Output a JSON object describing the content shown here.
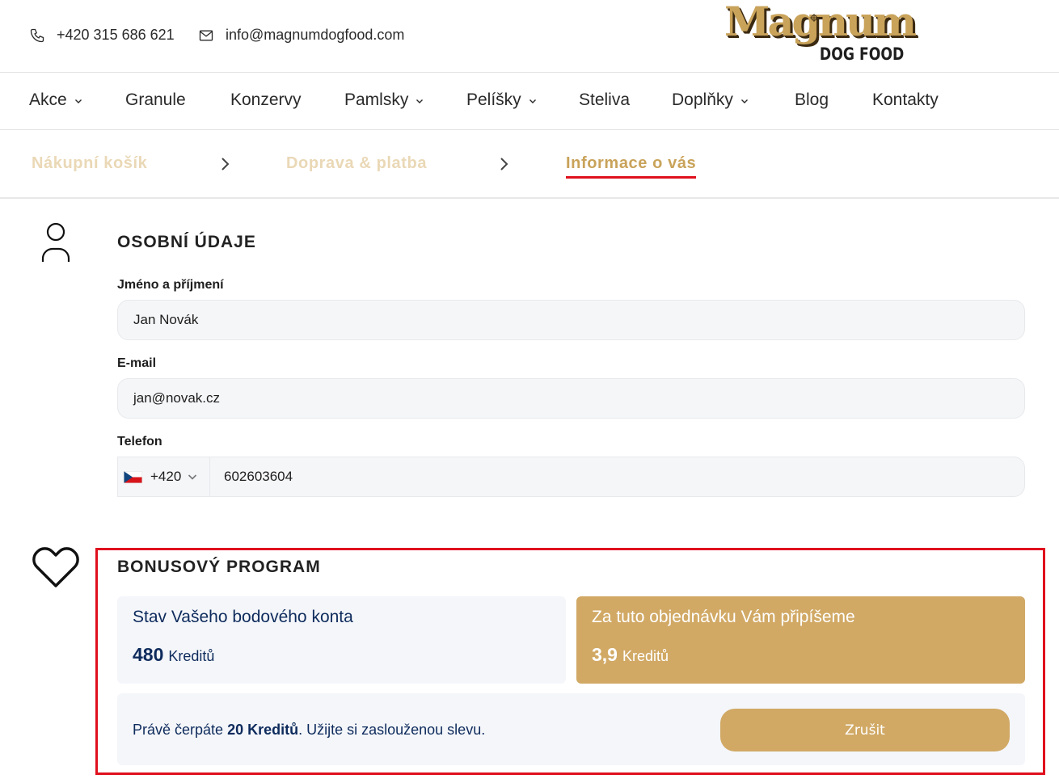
{
  "header": {
    "phone": "+420 315 686 621",
    "email": "info@magnumdogfood.com",
    "phone_icon": "phone-icon",
    "email_icon": "envelope-icon",
    "logo_brand": "Magnum",
    "logo_sub": "DOG FOOD"
  },
  "nav": {
    "items": [
      {
        "label": "Akce",
        "has_dropdown": true
      },
      {
        "label": "Granule",
        "has_dropdown": false
      },
      {
        "label": "Konzervy",
        "has_dropdown": false
      },
      {
        "label": "Pamlsky",
        "has_dropdown": true
      },
      {
        "label": "Pelíšky",
        "has_dropdown": true
      },
      {
        "label": "Steliva",
        "has_dropdown": false
      },
      {
        "label": "Doplňky",
        "has_dropdown": true
      },
      {
        "label": "Blog",
        "has_dropdown": false
      },
      {
        "label": "Kontakty",
        "has_dropdown": false
      }
    ]
  },
  "steps": {
    "items": [
      {
        "label": "Nákupní košík",
        "state": "done"
      },
      {
        "label": "Doprava & platba",
        "state": "done"
      },
      {
        "label": "Informace o vás",
        "state": "active"
      }
    ]
  },
  "personal": {
    "title": "OSOBNÍ ÚDAJE",
    "name_label": "Jméno a příjmení",
    "name_value": "Jan Novák",
    "email_label": "E-mail",
    "email_value": "jan@novak.cz",
    "phone_label": "Telefon",
    "phone_prefix": "+420",
    "phone_value": "602603604",
    "icon": "user-icon"
  },
  "bonus": {
    "title": "BONUSOVÝ PROGRAM",
    "icon": "heart-icon",
    "balance_title": "Stav Vašeho bodového konta",
    "balance_value": "480",
    "balance_unit": "Kreditů",
    "earn_title": "Za tuto objednávku Vám připíšeme",
    "earn_value": "3,9",
    "earn_unit": "Kreditů",
    "redeem_prefix": "Právě čerpáte ",
    "redeem_amount": "20 Kreditů",
    "redeem_suffix": ". Užijte si zaslouženou slevu.",
    "cancel_label": "Zrušit"
  },
  "colors": {
    "gold": "#d1a965",
    "gold_light": "#ead8b6",
    "navy": "#0e2b5c",
    "accent_red": "#e0101e",
    "field_bg": "#f5f6f8"
  }
}
